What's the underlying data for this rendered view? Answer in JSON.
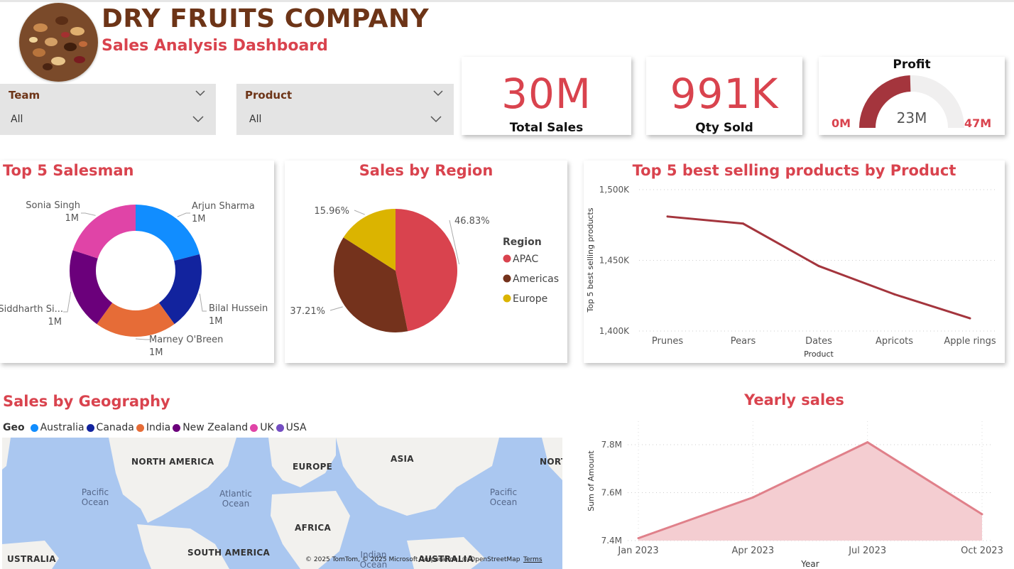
{
  "header": {
    "company": "DRY FRUITS COMPANY",
    "subtitle": "Sales Analysis Dashboard"
  },
  "slicers": [
    {
      "label": "Team",
      "value": "All"
    },
    {
      "label": "Product",
      "value": "All"
    }
  ],
  "kpis": {
    "total_sales": {
      "value": "30M",
      "label": "Total Sales"
    },
    "qty_sold": {
      "value": "991K",
      "label": "Qty Sold"
    },
    "profit": {
      "title": "Profit",
      "min": "0M",
      "max": "47M",
      "value": "23M",
      "fraction": 0.49
    }
  },
  "colors": {
    "accent": "#d9434e",
    "brand_brown": "#6d3417",
    "gauge_fill": "#a4353d",
    "gauge_bg": "#f0efef",
    "line": "#a4353d",
    "area_line": "#e0808a",
    "area_fill": "#f4cdd1"
  },
  "panels": {
    "salesman_title": "Top 5 Salesman",
    "region_title": "Sales by Region",
    "products_title": "Top 5 best selling products by Product",
    "geo_title": "Sales by Geography",
    "yearly_title": "Yearly sales"
  },
  "chart_data": [
    {
      "type": "pie",
      "variant": "donut",
      "title": "Top 5 Salesman",
      "slices": [
        {
          "name": "Arjun Sharma",
          "label": "1M",
          "share": 0.21,
          "color": "#118dff"
        },
        {
          "name": "Bilal Hussein",
          "label": "1M",
          "share": 0.19,
          "color": "#12239e"
        },
        {
          "name": "Marney O'Breen",
          "label": "1M",
          "share": 0.2,
          "color": "#e66c37"
        },
        {
          "name": "Siddharth Si...",
          "label": "1M",
          "share": 0.2,
          "color": "#6b007b"
        },
        {
          "name": "Sonia Singh",
          "label": "1M",
          "share": 0.2,
          "color": "#e044a7"
        }
      ]
    },
    {
      "type": "pie",
      "title": "Sales by Region",
      "legend_title": "Region",
      "slices": [
        {
          "name": "APAC",
          "value": 46.83,
          "label": "46.83%",
          "color": "#d9434e"
        },
        {
          "name": "Americas",
          "value": 37.21,
          "label": "37.21%",
          "color": "#74321c"
        },
        {
          "name": "Europe",
          "value": 15.96,
          "label": "15.96%",
          "color": "#dbb400"
        }
      ]
    },
    {
      "type": "line",
      "title": "Top 5 best selling products by Product",
      "xlabel": "Product",
      "ylabel": "Top 5 best selling products",
      "categories": [
        "Prunes",
        "Pears",
        "Dates",
        "Apricots",
        "Apple rings"
      ],
      "values": [
        1481000,
        1476000,
        1446000,
        1426000,
        1409000
      ],
      "ylim": [
        1400000,
        1500000
      ],
      "yticks": [
        "1,400K",
        "1,450K",
        "1,500K"
      ],
      "grid": true
    },
    {
      "type": "area",
      "title": "Yearly sales",
      "xlabel": "Year",
      "ylabel": "Sum of Amount",
      "categories": [
        "Jan 2023",
        "Apr 2023",
        "Jul 2023",
        "Oct 2023"
      ],
      "values": [
        7410000,
        7580000,
        7810000,
        7510000
      ],
      "ylim": [
        7400000,
        7800000
      ],
      "yticks": [
        "7.4M",
        "7.6M",
        "7.8M"
      ],
      "grid": true
    }
  ],
  "geo": {
    "legend_title": "Geo",
    "items": [
      {
        "name": "Australia",
        "color": "#118dff"
      },
      {
        "name": "Canada",
        "color": "#12239e"
      },
      {
        "name": "India",
        "color": "#e66c37"
      },
      {
        "name": "New Zealand",
        "color": "#6b007b"
      },
      {
        "name": "UK",
        "color": "#e044a7"
      },
      {
        "name": "USA",
        "color": "#744ec2"
      }
    ],
    "map_labels": {
      "north_america": "NORTH AMERICA",
      "europe": "EUROPE",
      "asia": "ASIA",
      "nort": "NORT",
      "africa": "AFRICA",
      "south_america": "SOUTH AMERICA",
      "australia_left": "USTRALIA",
      "australia_right": "AUSTRALIA",
      "pacific_left": "Pacific Ocean",
      "atlantic": "Atlantic Ocean",
      "pacific_right": "Pacific Ocean",
      "indian": "Indian Ocean"
    },
    "attribution": "© 2025 TomTom, © 2025 Microsoft Corporation, © OpenStreetMap",
    "terms": "Terms"
  }
}
